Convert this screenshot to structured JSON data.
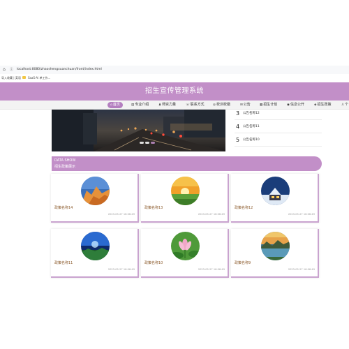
{
  "browser": {
    "url": "localhost:8080/zhaoshengxuanchuan/front/index.html",
    "bookmarks": [
      "导入收藏 | 英语",
      "SaaS-Ai 单工作..."
    ]
  },
  "banner": {
    "title": "招生宣传管理系统"
  },
  "nav": {
    "items": [
      {
        "icon": "home-icon",
        "label": "首页"
      },
      {
        "icon": "book-icon",
        "label": "专业介绍"
      },
      {
        "icon": "teacher-icon",
        "label": "师资力量"
      },
      {
        "icon": "phone-icon",
        "label": "联系方式"
      },
      {
        "icon": "school-icon",
        "label": "校训校徽"
      },
      {
        "icon": "notice-icon",
        "label": "公告"
      },
      {
        "icon": "plan-icon",
        "label": "招生计划"
      },
      {
        "icon": "info-icon",
        "label": "信息公开"
      },
      {
        "icon": "policy-icon",
        "label": "招生政策"
      },
      {
        "icon": "user-icon",
        "label": "个"
      }
    ]
  },
  "notices": [
    {
      "num": "3",
      "title": "公告名称12"
    },
    {
      "num": "4",
      "title": "公告名称11"
    },
    {
      "num": "5",
      "title": "公告名称10"
    }
  ],
  "section": {
    "title_en": "DATA SHOW",
    "title_cn": "招生政策展示"
  },
  "cards": [
    {
      "name": "政策名称14",
      "date": "2023-05-27 16:06:49",
      "image": "mountain-image"
    },
    {
      "name": "政策名称13",
      "date": "2023-05-27 16:06:49",
      "image": "sunset-field-image"
    },
    {
      "name": "政策名称12",
      "date": "2023-05-27 16:06:49",
      "image": "snow-cabin-image"
    },
    {
      "name": "政策名称11",
      "date": "2023-05-27 16:06:49",
      "image": "night-sky-image"
    },
    {
      "name": "政策名称10",
      "date": "2023-05-27 16:06:49",
      "image": "lotus-image"
    },
    {
      "name": "政策名称9",
      "date": "2023-05-27 16:06:49",
      "image": "lake-sunset-image"
    }
  ],
  "colors": {
    "accent": "#c28fc8",
    "accent_dark": "#b47fc0",
    "card_border": "#c9a3cf",
    "card_name": "#8b5a2b"
  }
}
